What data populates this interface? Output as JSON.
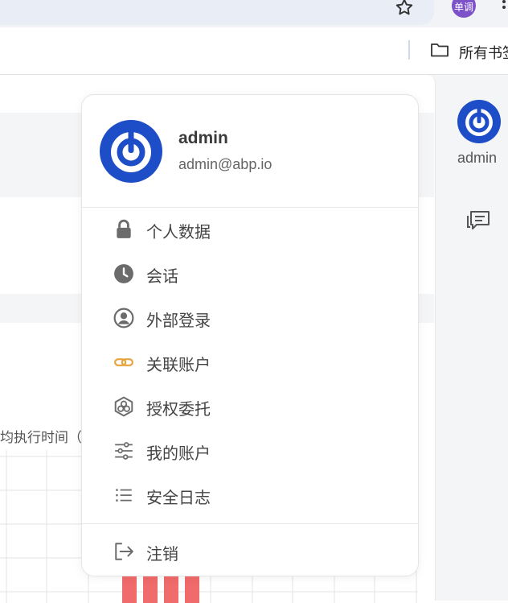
{
  "browser": {
    "profile_label": "单调",
    "bookmarks_folder_label": "所有书签"
  },
  "page": {
    "chart_title_fragment": "均执行时间（",
    "rail_user_name": "admin"
  },
  "user_menu": {
    "username": "admin",
    "email": "admin@abp.io",
    "items": [
      {
        "label": "个人数据",
        "icon": "lock-icon"
      },
      {
        "label": "会话",
        "icon": "clock-icon"
      },
      {
        "label": "外部登录",
        "icon": "user-circle-icon"
      },
      {
        "label": "关联账户",
        "icon": "link-icon"
      },
      {
        "label": "授权委托",
        "icon": "hexagon-users-icon"
      },
      {
        "label": "我的账户",
        "icon": "sliders-icon"
      },
      {
        "label": "安全日志",
        "icon": "list-icon"
      }
    ],
    "logout_label": "注销",
    "logout_icon": "logout-icon"
  },
  "colors": {
    "avatar_blue": "#1e4dc8",
    "link_orange": "#e8a33c",
    "bar_red": "#f06b6b"
  }
}
